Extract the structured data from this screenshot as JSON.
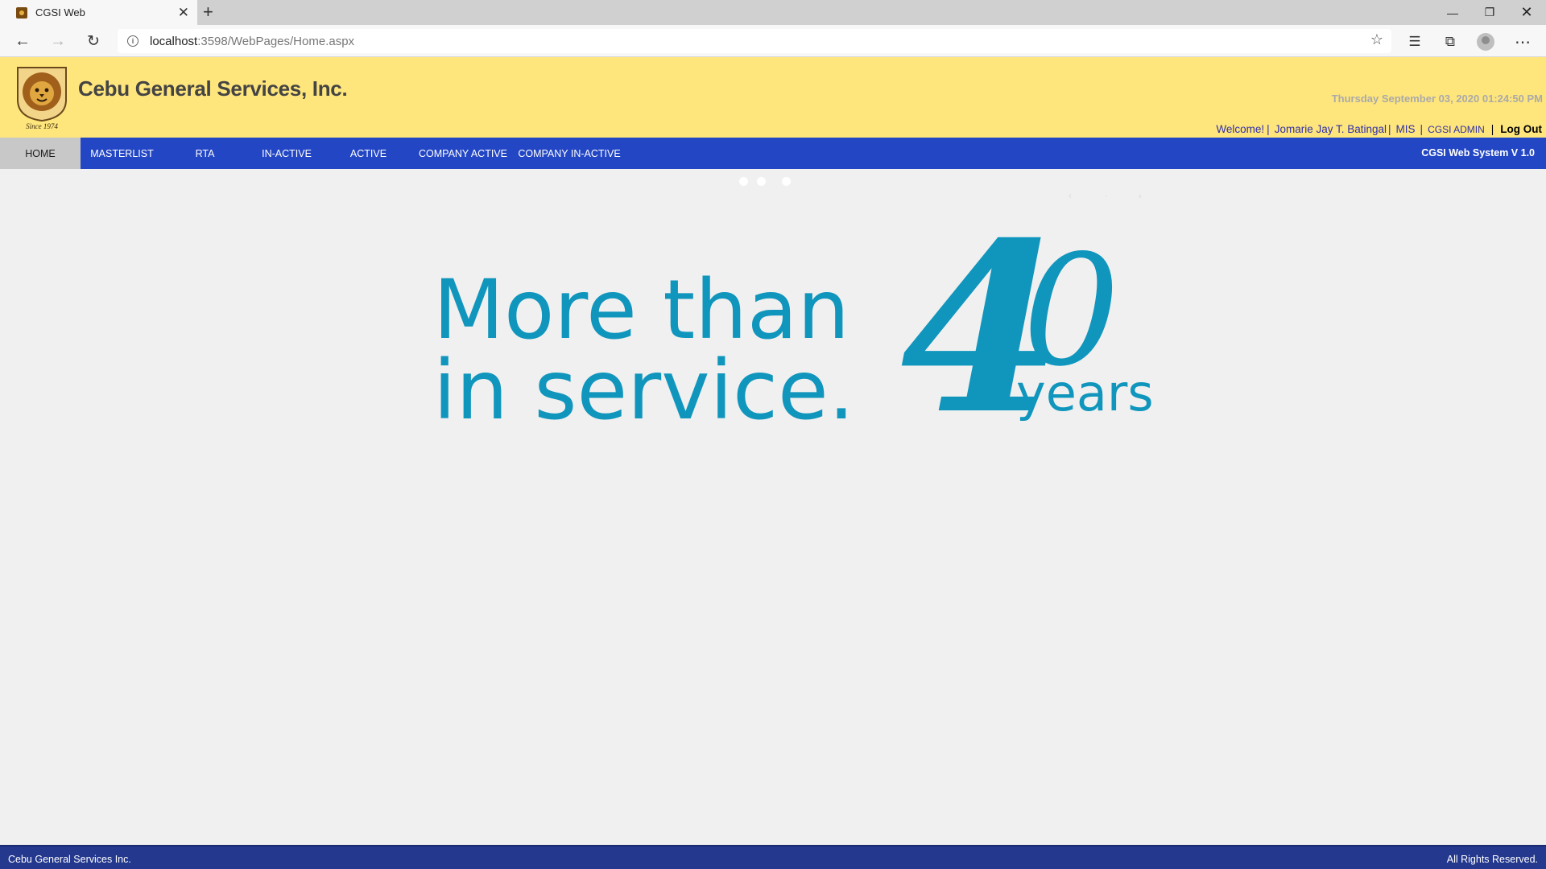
{
  "browser": {
    "tab_title": "CGSI Web",
    "url_host": "localhost",
    "url_rest": ":3598/WebPages/Home.aspx"
  },
  "header": {
    "company_name": "Cebu General Services, Inc.",
    "logo_caption": "Since 1974",
    "datetime": "Thursday September 03, 2020 01:24:50 PM",
    "welcome": "Welcome!",
    "user_name": "Jomarie Jay T. Batingal",
    "department": "MIS",
    "role": "CGSI ADMIN",
    "logout": "Log Out"
  },
  "nav": {
    "items": [
      {
        "label": "HOME"
      },
      {
        "label": "MASTERLIST"
      },
      {
        "label": "RTA"
      },
      {
        "label": "IN-ACTIVE"
      },
      {
        "label": "ACTIVE"
      },
      {
        "label": "COMPANY ACTIVE"
      },
      {
        "label": "COMPANY IN-ACTIVE"
      }
    ],
    "system_version": "CGSI Web System V 1.0"
  },
  "banner": {
    "line1": "More than",
    "line2": "in service.",
    "number_first": "4",
    "number_second": "0",
    "unit": "years",
    "color": "#1096bd"
  },
  "footer": {
    "left": "Cebu General Services Inc.",
    "right": "All Rights Reserved."
  },
  "colors": {
    "header_bg": "#fee57c",
    "nav_bg": "#2346c4",
    "footer_bg": "#24388e"
  }
}
